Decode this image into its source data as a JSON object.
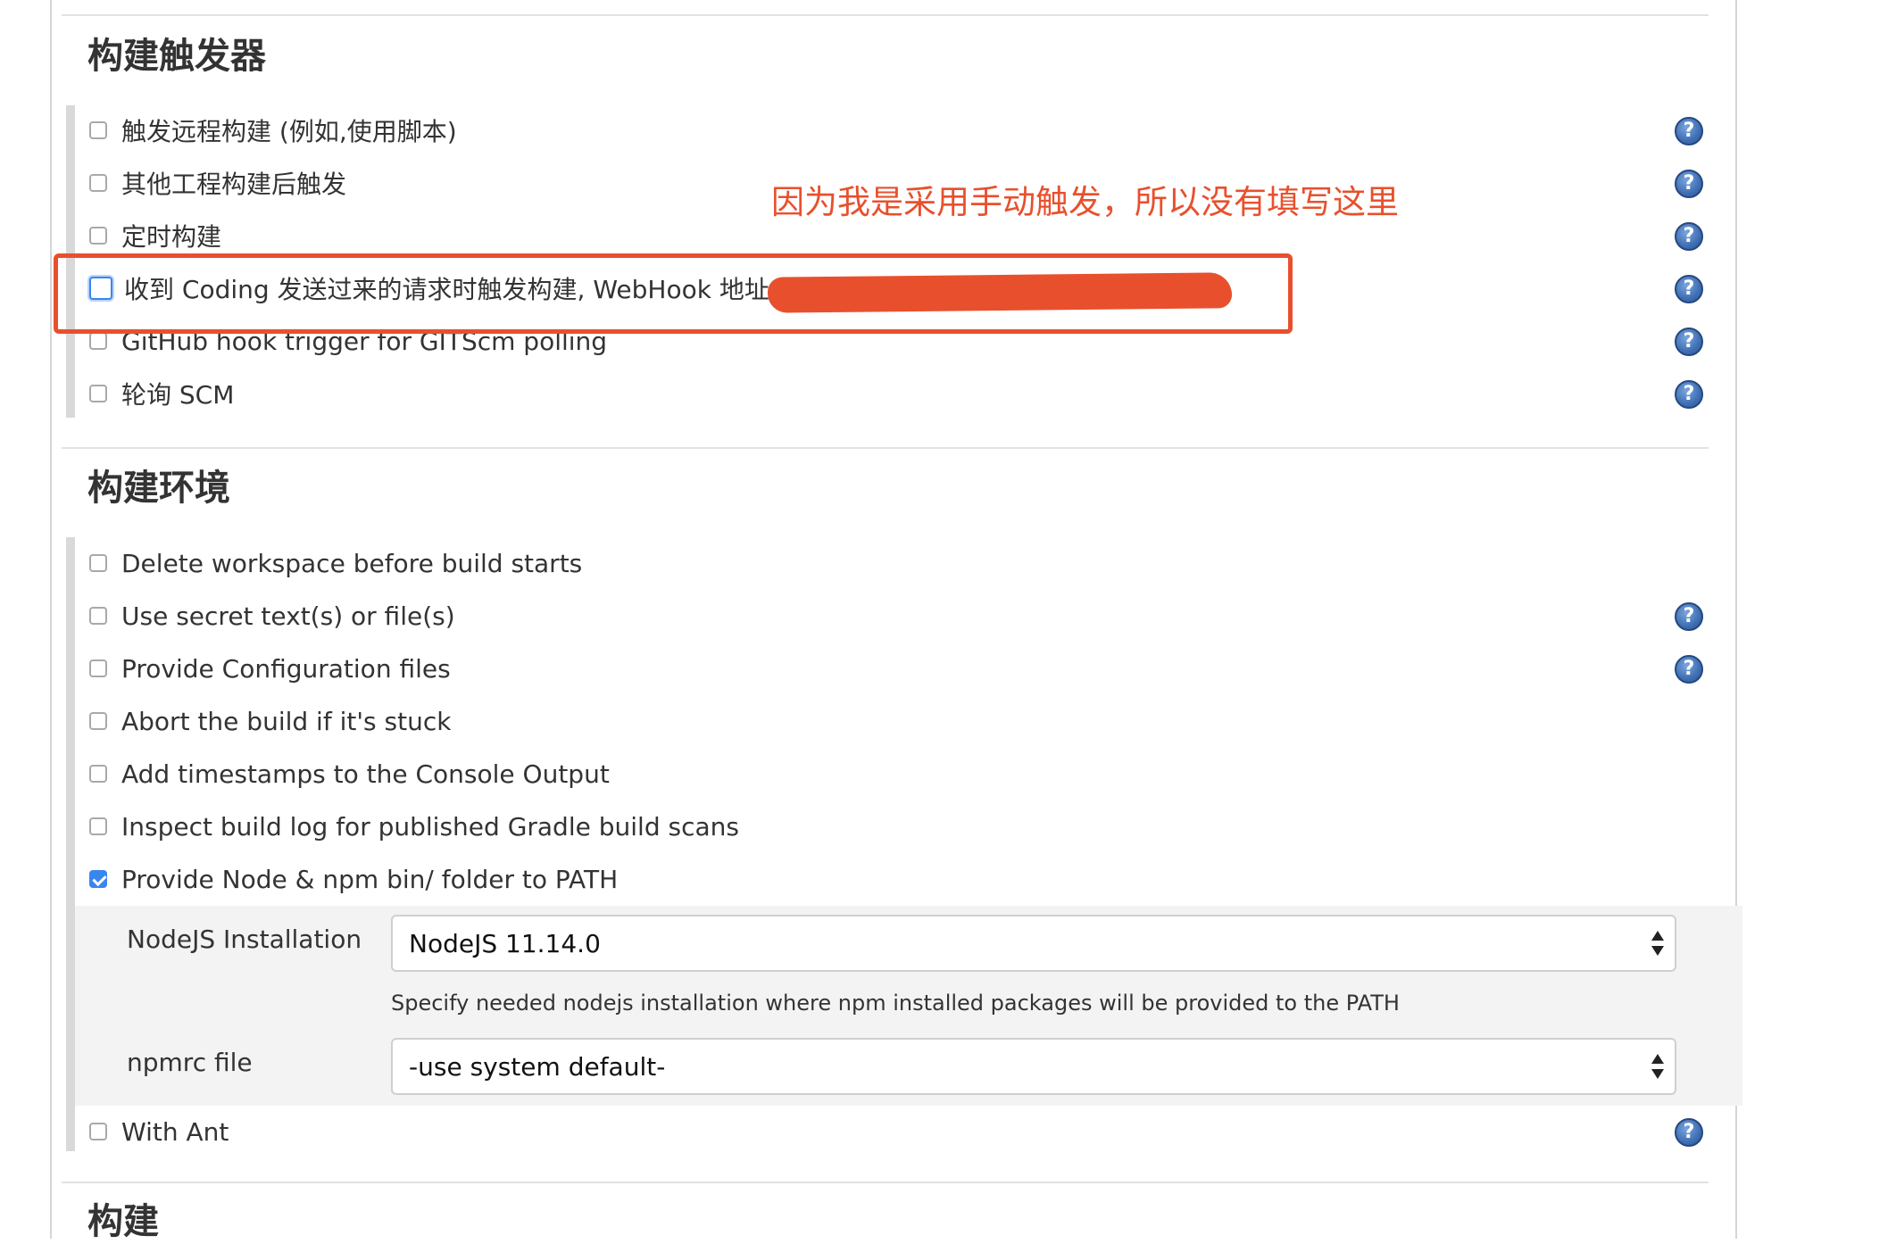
{
  "sections": {
    "triggers_title": "构建触发器",
    "env_title": "构建环境",
    "build_title": "构建"
  },
  "triggers": [
    {
      "label": "触发远程构建 (例如,使用脚本)",
      "checked": false,
      "help": true
    },
    {
      "label": "其他工程构建后触发",
      "checked": false,
      "help": true
    },
    {
      "label": "定时构建",
      "checked": false,
      "help": true
    },
    {
      "label": "收到 Coding 发送过来的请求时触发构建, WebHook 地址:",
      "checked": false,
      "help": true
    },
    {
      "label": "GitHub hook trigger for GITScm polling",
      "checked": false,
      "help": true
    },
    {
      "label": "轮询 SCM",
      "checked": false,
      "help": true
    }
  ],
  "environment": [
    {
      "label": "Delete workspace before build starts",
      "checked": false,
      "help": false
    },
    {
      "label": "Use secret text(s) or file(s)",
      "checked": false,
      "help": true
    },
    {
      "label": "Provide Configuration files",
      "checked": false,
      "help": true
    },
    {
      "label": "Abort the build if it's stuck",
      "checked": false,
      "help": false
    },
    {
      "label": "Add timestamps to the Console Output",
      "checked": false,
      "help": false
    },
    {
      "label": "Inspect build log for published Gradle build scans",
      "checked": false,
      "help": false
    },
    {
      "label": "Provide Node & npm bin/ folder to PATH",
      "checked": true,
      "help": false
    },
    {
      "label": "With Ant",
      "checked": false,
      "help": true
    }
  ],
  "node_panel": {
    "installation_label": "NodeJS Installation",
    "installation_value": "NodeJS 11.14.0",
    "installation_hint": "Specify needed nodejs installation where npm installed packages will be provided to the PATH",
    "npmrc_label": "npmrc file",
    "npmrc_value": "-use system default-"
  },
  "annotation": {
    "text": "因为我是采用手动触发，所以没有填写这里",
    "color": "#e8502d"
  },
  "help_glyph": "?",
  "icons": {
    "help": "help-icon",
    "checkbox": "checkbox-icon"
  }
}
